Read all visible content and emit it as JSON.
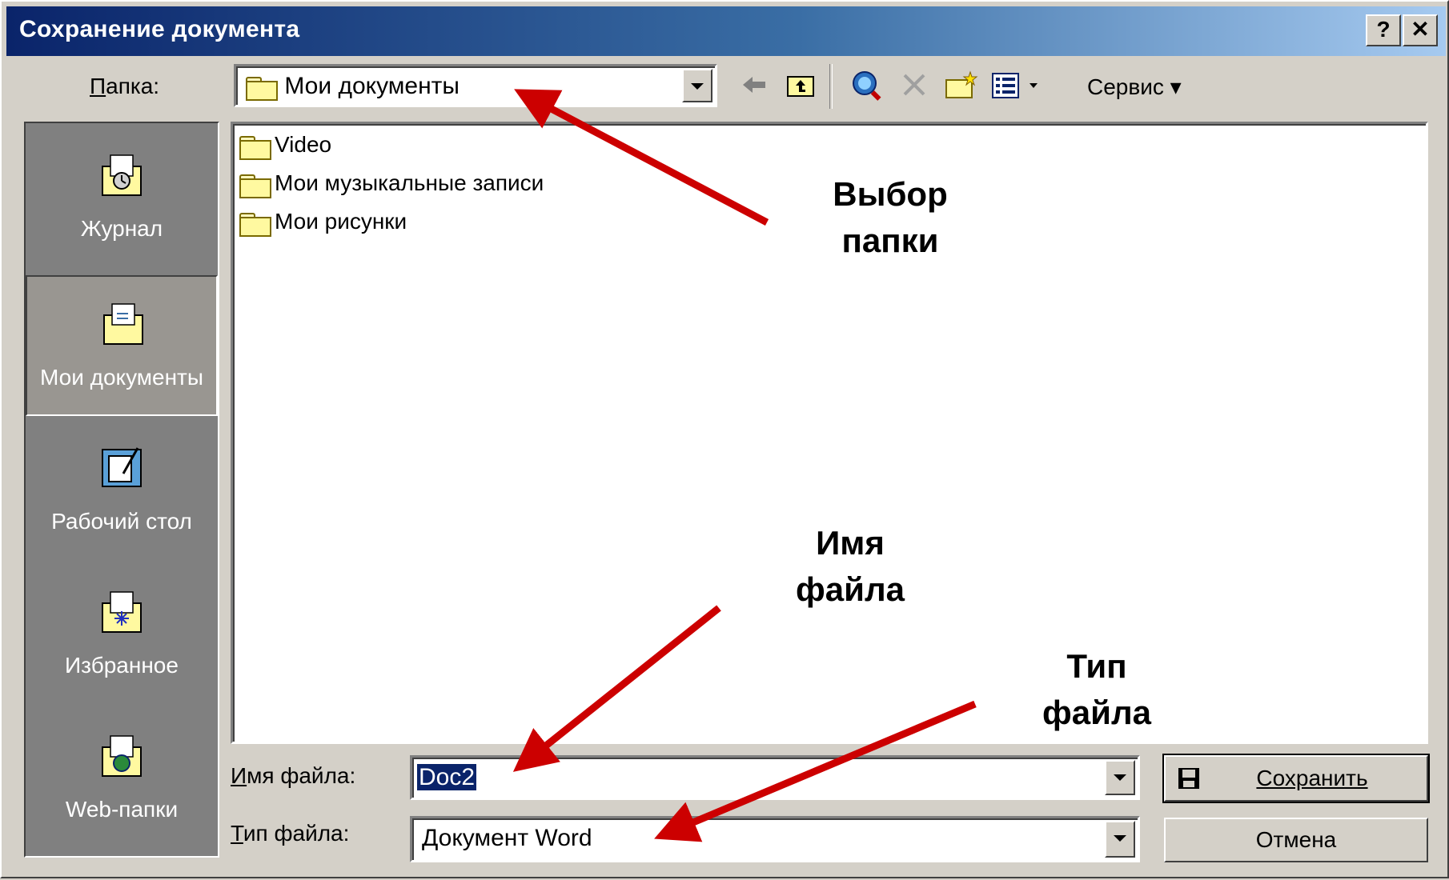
{
  "window": {
    "title": "Сохранение документа",
    "help_label": "?",
    "close_label": "✕"
  },
  "folder_bar": {
    "label": "Папка:",
    "value": "Мои документы",
    "tools_label": "Сервис"
  },
  "toolbar_icons": [
    "back-icon",
    "up-folder-icon",
    "search-web-icon",
    "delete-icon",
    "new-folder-icon",
    "views-icon"
  ],
  "sidebar": {
    "items": [
      {
        "label": "Журнал",
        "icon": "history-icon"
      },
      {
        "label": "Мои документы",
        "icon": "my-documents-icon",
        "selected": true
      },
      {
        "label": "Рабочий стол",
        "icon": "desktop-icon"
      },
      {
        "label": "Избранное",
        "icon": "favorites-icon"
      },
      {
        "label": "Web-папки",
        "icon": "web-folders-icon"
      }
    ]
  },
  "files": [
    {
      "name": "Video",
      "icon": "folder-icon"
    },
    {
      "name": "Мои музыкальные записи",
      "icon": "folder-icon"
    },
    {
      "name": "Мои рисунки",
      "icon": "pictures-folder-icon"
    }
  ],
  "filename": {
    "label": "Имя файла:",
    "value": "Doc2"
  },
  "filetype": {
    "label": "Тип файла:",
    "value": "Документ Word"
  },
  "buttons": {
    "save": "Сохранить",
    "cancel": "Отмена"
  },
  "annotations": {
    "folder_choice": [
      "Выбор",
      "папки"
    ],
    "file_name": [
      "Имя",
      "файла"
    ],
    "file_type": [
      "Тип",
      "файла"
    ]
  },
  "colors": {
    "arrow": "#cc0000",
    "title_start": "#0a246a",
    "sidebar": "#808080"
  }
}
